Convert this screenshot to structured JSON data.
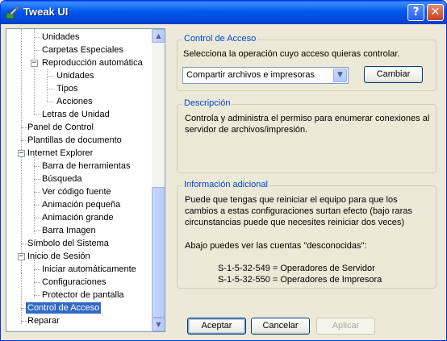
{
  "window": {
    "title": "Tweak UI"
  },
  "tree": {
    "items": [
      "Unidades",
      "Carpetas Especiales",
      "Reproducción automática",
      "Unidades",
      "Tipos",
      "Acciones",
      "Letras de Unidad",
      "Panel de Control",
      "Plantillas de documento",
      "Internet Explorer",
      "Barra de herramientas",
      "Búsqueda",
      "Ver código fuente",
      "Animación pequeña",
      "Animación grande",
      "Barra Imagen",
      "Símbolo del Sistema",
      "Inicio de Sesión",
      "Iniciar automáticamente",
      "Configuraciones",
      "Protector de pantalla",
      "Control de Acceso",
      "Reparar"
    ],
    "selected": "Control de Acceso"
  },
  "access": {
    "legend": "Control de Acceso",
    "prompt": "Selecciona la operación cuyo acceso quieras controlar.",
    "selected_option": "Compartir archivos e impresoras",
    "change_label": "Cambiar"
  },
  "description": {
    "legend": "Descripción",
    "line1": "Controla y administra el permiso para enumerar conexiones al",
    "line2": "servidor de archivos/impresión."
  },
  "info": {
    "legend": "Información adicional",
    "line1": "Puede que tengas que reiniciar el equipo para que los",
    "line2": "cambios a estas configuraciones surtan efecto (bajo raras",
    "line3": "circunstancias puede que necesites reiniciar dos veces)",
    "line4": "Abajo puedes ver las cuentas \"desconocidas\":",
    "line5": "S-1-5-32-549 = Operadores de Servidor",
    "line6": "S-1-5-32-550 = Operadores de Impresora"
  },
  "footer": {
    "accept": "Aceptar",
    "cancel": "Cancelar",
    "apply": "Aplicar"
  }
}
